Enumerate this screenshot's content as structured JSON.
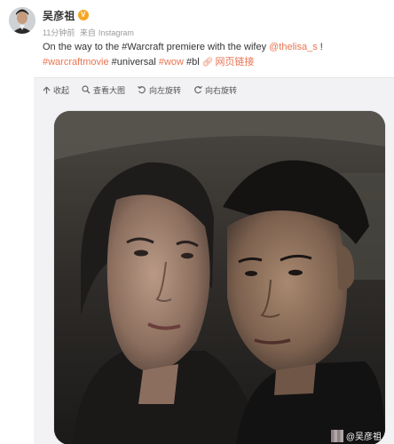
{
  "post": {
    "author": "吴彦祖",
    "time": "11分钟前",
    "source_prefix": "来自",
    "source": "Instagram",
    "text_prefix": "On the way to the #Warcraft premiere with the wifey ",
    "mention": "@thelisa_s",
    "text_suffix": " !",
    "tags": [
      "#warcraftmovie",
      "#universal",
      "#wow",
      "#bl"
    ],
    "web_link": "网页链接"
  },
  "toolbar": {
    "collapse": "收起",
    "view_large": "查看大图",
    "rotate_left": "向左旋转",
    "rotate_right": "向右旋转"
  },
  "watermark": {
    "text": "@吴彦祖"
  },
  "colors": {
    "link": "#eb7350",
    "vip": "#f6a623",
    "media_bg": "#f2f2f5"
  },
  "icons": [
    "verified-icon",
    "collapse-icon",
    "zoom-icon",
    "rotate-left-icon",
    "rotate-right-icon",
    "link-icon"
  ]
}
